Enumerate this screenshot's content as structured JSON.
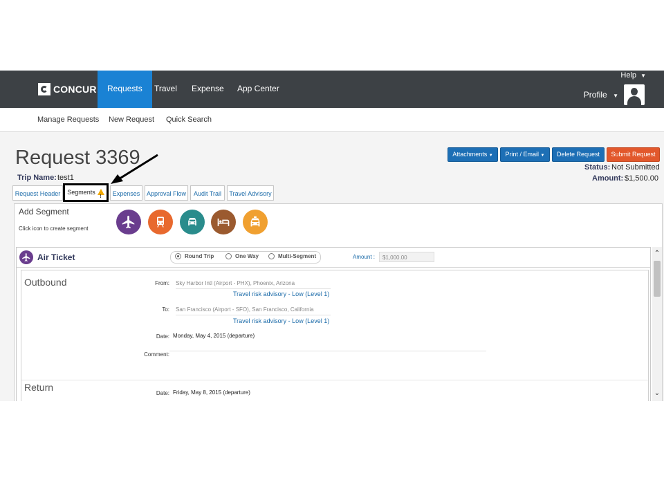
{
  "nav": {
    "logo_text": "CONCUR",
    "items": [
      {
        "label": "Requests"
      },
      {
        "label": "Travel"
      },
      {
        "label": "Expense"
      },
      {
        "label": "App Center"
      }
    ],
    "help": "Help",
    "profile": "Profile"
  },
  "subnav": {
    "items": [
      {
        "label": "Manage Requests"
      },
      {
        "label": "New Request"
      },
      {
        "label": "Quick Search"
      }
    ]
  },
  "header": {
    "title": "Request 3369",
    "trip_name_label": "Trip Name:",
    "trip_name_value": "test1",
    "status_label": "Status:",
    "status_value": "Not Submitted",
    "amount_label": "Amount:",
    "amount_value": "$1,500.00"
  },
  "buttons": {
    "attachments": "Attachments",
    "print_email": "Print / Email",
    "delete_request": "Delete Request",
    "submit_request": "Submit Request"
  },
  "tabs": [
    {
      "label": "Request Header"
    },
    {
      "label": "Segments"
    },
    {
      "label": "Expenses"
    },
    {
      "label": "Approval Flow"
    },
    {
      "label": "Audit Trail"
    },
    {
      "label": "Travel Advisory"
    }
  ],
  "add_segment": {
    "title": "Add Segment",
    "subtitle": "Click icon to create segment",
    "icons": [
      {
        "name": "airplane-icon",
        "color": "#6a3d8e"
      },
      {
        "name": "train-icon",
        "color": "#e8692e"
      },
      {
        "name": "car-icon",
        "color": "#2a8c8c"
      },
      {
        "name": "hotel-bed-icon",
        "color": "#9b5a2f"
      },
      {
        "name": "taxi-icon",
        "color": "#f0a030"
      }
    ]
  },
  "air_ticket": {
    "title": "Air Ticket",
    "trip_types": [
      {
        "label": "Round Trip",
        "selected": true
      },
      {
        "label": "One Way",
        "selected": false
      },
      {
        "label": "Multi-Segment",
        "selected": false
      }
    ],
    "amount_label": "Amount :",
    "amount_placeholder": "$1,000.00",
    "outbound": {
      "title": "Outbound",
      "from_label": "From:",
      "from_value": "Sky Harbor Intl (Airport - PHX), Phoenix, Arizona",
      "from_advisory": "Travel risk advisory - Low (Level 1)",
      "to_label": "To:",
      "to_value": "San Francisco (Airport - SFO), San Francisco, California",
      "to_advisory": "Travel risk advisory - Low (Level 1)",
      "date_label": "Date:",
      "date_value": "Monday, May 4, 2015 (departure)",
      "comment_label": "Comment:"
    },
    "return": {
      "title": "Return",
      "date_label": "Date:",
      "date_value": "Friday, May 8, 2015 (departure)"
    }
  }
}
